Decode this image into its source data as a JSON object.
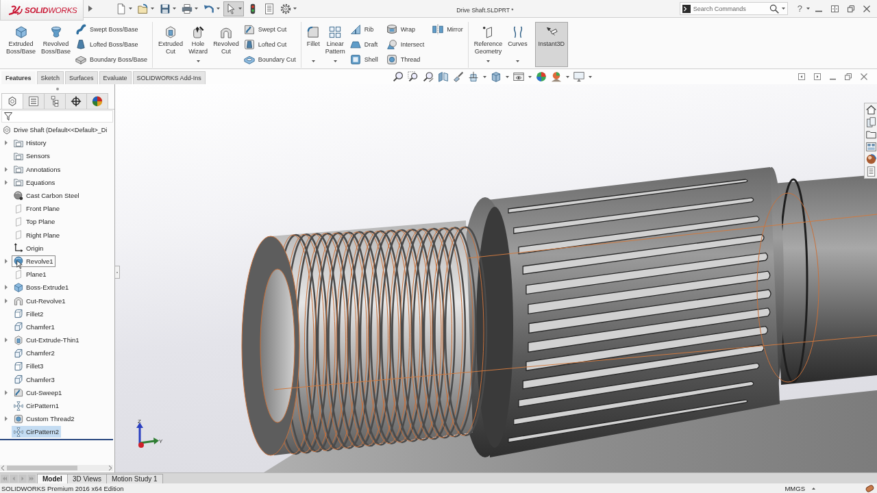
{
  "title_bar": {
    "logo": "**SOLID**WORKS",
    "document_title": "Drive Shaft.SLDPRT *",
    "search": {
      "placeholder": "Search Commands"
    },
    "help": "?"
  },
  "quick_access": [
    {
      "kind": "new",
      "dropdown": true,
      "selected": false
    },
    {
      "kind": "open",
      "dropdown": true,
      "selected": false
    },
    {
      "kind": "save",
      "dropdown": true,
      "selected": false
    },
    {
      "kind": "print",
      "dropdown": true,
      "selected": false
    },
    {
      "kind": "undo",
      "dropdown": true,
      "selected": false
    },
    {
      "kind": "select",
      "dropdown": true,
      "selected": true
    },
    {
      "kind": "rebuild",
      "dropdown": false,
      "selected": false
    },
    {
      "kind": "properties",
      "dropdown": false,
      "selected": false
    },
    {
      "kind": "options",
      "dropdown": true,
      "selected": false
    }
  ],
  "ribbon": {
    "groups": [
      {
        "large": [
          {
            "label": "Extruded Boss/Base",
            "kind": "extrude",
            "dropdown": false,
            "selected": false
          },
          {
            "label": "Revolved Boss/Base",
            "kind": "revolve",
            "dropdown": false,
            "selected": false
          }
        ],
        "small_columns": [
          [
            {
              "label": "Swept Boss/Base",
              "kind": "sweep"
            },
            {
              "label": "Lofted Boss/Base",
              "kind": "loft"
            },
            {
              "label": "Boundary Boss/Base",
              "kind": "boundary"
            }
          ]
        ]
      },
      {
        "large": [
          {
            "label": "Extruded Cut",
            "kind": "extrudecut",
            "dropdown": false,
            "selected": false
          },
          {
            "label": "Hole Wizard",
            "kind": "hole",
            "dropdown": true,
            "selected": false
          },
          {
            "label": "Revolved Cut",
            "kind": "revolvecut",
            "dropdown": false,
            "selected": false
          }
        ],
        "small_columns": [
          [
            {
              "label": "Swept Cut",
              "kind": "sweepcut"
            },
            {
              "label": "Lofted Cut",
              "kind": "loftcut"
            },
            {
              "label": "Boundary Cut",
              "kind": "boundarycut"
            }
          ]
        ]
      },
      {
        "large": [
          {
            "label": "Fillet",
            "kind": "fillet",
            "dropdown": true,
            "selected": false
          },
          {
            "label": "Linear Pattern",
            "kind": "pattern",
            "dropdown": true,
            "selected": false
          }
        ],
        "small_columns": [
          [
            {
              "label": "Rib",
              "kind": "rib"
            },
            {
              "label": "Draft",
              "kind": "draft"
            },
            {
              "label": "Shell",
              "kind": "shell"
            }
          ],
          [
            {
              "label": "Wrap",
              "kind": "wrap"
            },
            {
              "label": "Intersect",
              "kind": "intersect"
            },
            {
              "label": "Thread",
              "kind": "thread"
            }
          ],
          [
            {
              "label": "Mirror",
              "kind": "mirror"
            }
          ]
        ]
      },
      {
        "large": [
          {
            "label": "Reference Geometry",
            "kind": "reference",
            "dropdown": true,
            "selected": false
          },
          {
            "label": "Curves",
            "kind": "curves",
            "dropdown": true,
            "selected": false
          },
          {
            "label": "Instant3D",
            "kind": "instant3d",
            "dropdown": false,
            "selected": true
          }
        ]
      }
    ]
  },
  "command_tabs": [
    {
      "label": "Features",
      "selected": true
    },
    {
      "label": "Sketch",
      "selected": false
    },
    {
      "label": "Surfaces",
      "selected": false
    },
    {
      "label": "Evaluate",
      "selected": false
    },
    {
      "label": "SOLIDWORKS Add-Ins",
      "selected": false
    }
  ],
  "view_toolbar": [
    {
      "kind": "zoomfit",
      "dropdown": false
    },
    {
      "kind": "zoomarea",
      "dropdown": false
    },
    {
      "kind": "previous",
      "dropdown": false
    },
    {
      "kind": "section",
      "dropdown": false
    },
    {
      "kind": "annotations",
      "dropdown": false
    },
    {
      "kind": "orientation",
      "dropdown": true
    },
    {
      "kind": "display",
      "dropdown": true
    },
    {
      "kind": "hideshow",
      "dropdown": true
    },
    {
      "kind": "appearance",
      "dropdown": false
    },
    {
      "kind": "scene",
      "dropdown": true
    },
    {
      "kind": "settings",
      "dropdown": true
    }
  ],
  "feature_tree": {
    "panel_tabs": [
      {
        "kind": "feature",
        "selected": true
      },
      {
        "kind": "property",
        "selected": false
      },
      {
        "kind": "configuration",
        "selected": false
      },
      {
        "kind": "dimxpert",
        "selected": false
      },
      {
        "kind": "display",
        "selected": false
      }
    ],
    "root": {
      "label": "Drive Shaft (Default<<Default>_Di"
    },
    "items": [
      {
        "label": "History",
        "kind": "folder",
        "expandable": true,
        "selected": false,
        "hovered": false
      },
      {
        "label": "Sensors",
        "kind": "folder",
        "expandable": false,
        "selected": false,
        "hovered": false
      },
      {
        "label": "Annotations",
        "kind": "folder",
        "expandable": true,
        "selected": false,
        "hovered": false
      },
      {
        "label": "Equations",
        "kind": "folder",
        "expandable": true,
        "selected": false,
        "hovered": false
      },
      {
        "label": "Cast Carbon Steel",
        "kind": "material",
        "expandable": false,
        "selected": false,
        "hovered": false
      },
      {
        "label": "Front Plane",
        "kind": "plane",
        "expandable": false,
        "selected": false,
        "hovered": false
      },
      {
        "label": "Top Plane",
        "kind": "plane",
        "expandable": false,
        "selected": false,
        "hovered": false
      },
      {
        "label": "Right Plane",
        "kind": "plane",
        "expandable": false,
        "selected": false,
        "hovered": false
      },
      {
        "label": "Origin",
        "kind": "origin",
        "expandable": false,
        "selected": false,
        "hovered": false
      },
      {
        "label": "Revolve1",
        "kind": "revolve",
        "expandable": true,
        "selected": false,
        "hovered": true
      },
      {
        "label": "Plane1",
        "kind": "plane",
        "expandable": false,
        "selected": false,
        "hovered": false
      },
      {
        "label": "Boss-Extrude1",
        "kind": "extrude",
        "expandable": true,
        "selected": false,
        "hovered": false
      },
      {
        "label": "Cut-Revolve1",
        "kind": "cutrevolve",
        "expandable": true,
        "selected": false,
        "hovered": false
      },
      {
        "label": "Fillet2",
        "kind": "fillet",
        "expandable": false,
        "selected": false,
        "hovered": false
      },
      {
        "label": "Chamfer1",
        "kind": "chamfer",
        "expandable": false,
        "selected": false,
        "hovered": false
      },
      {
        "label": "Cut-Extrude-Thin1",
        "kind": "cutextrude",
        "expandable": true,
        "selected": false,
        "hovered": false
      },
      {
        "label": "Chamfer2",
        "kind": "chamfer",
        "expandable": false,
        "selected": false,
        "hovered": false
      },
      {
        "label": "Fillet3",
        "kind": "fillet",
        "expandable": false,
        "selected": false,
        "hovered": false
      },
      {
        "label": "Chamfer3",
        "kind": "chamfer",
        "expandable": false,
        "selected": false,
        "hovered": false
      },
      {
        "label": "Cut-Sweep1",
        "kind": "cutsweep",
        "expandable": true,
        "selected": false,
        "hovered": false
      },
      {
        "label": "CirPattern1",
        "kind": "pattern",
        "expandable": false,
        "selected": false,
        "hovered": false
      },
      {
        "label": "Custom Thread2",
        "kind": "thread",
        "expandable": true,
        "selected": false,
        "hovered": false
      },
      {
        "label": "CirPattern2",
        "kind": "pattern",
        "expandable": false,
        "selected": true,
        "hovered": false
      }
    ]
  },
  "viewport": {
    "axis_labels": [
      "Z",
      "Y"
    ]
  },
  "bottom_tabs": [
    {
      "label": "Model",
      "selected": true
    },
    {
      "label": "3D Views",
      "selected": false
    },
    {
      "label": "Motion Study 1",
      "selected": false
    }
  ],
  "status_bar": {
    "edition": "SOLIDWORKS Premium 2016 x64 Edition",
    "units": "MMGS"
  }
}
